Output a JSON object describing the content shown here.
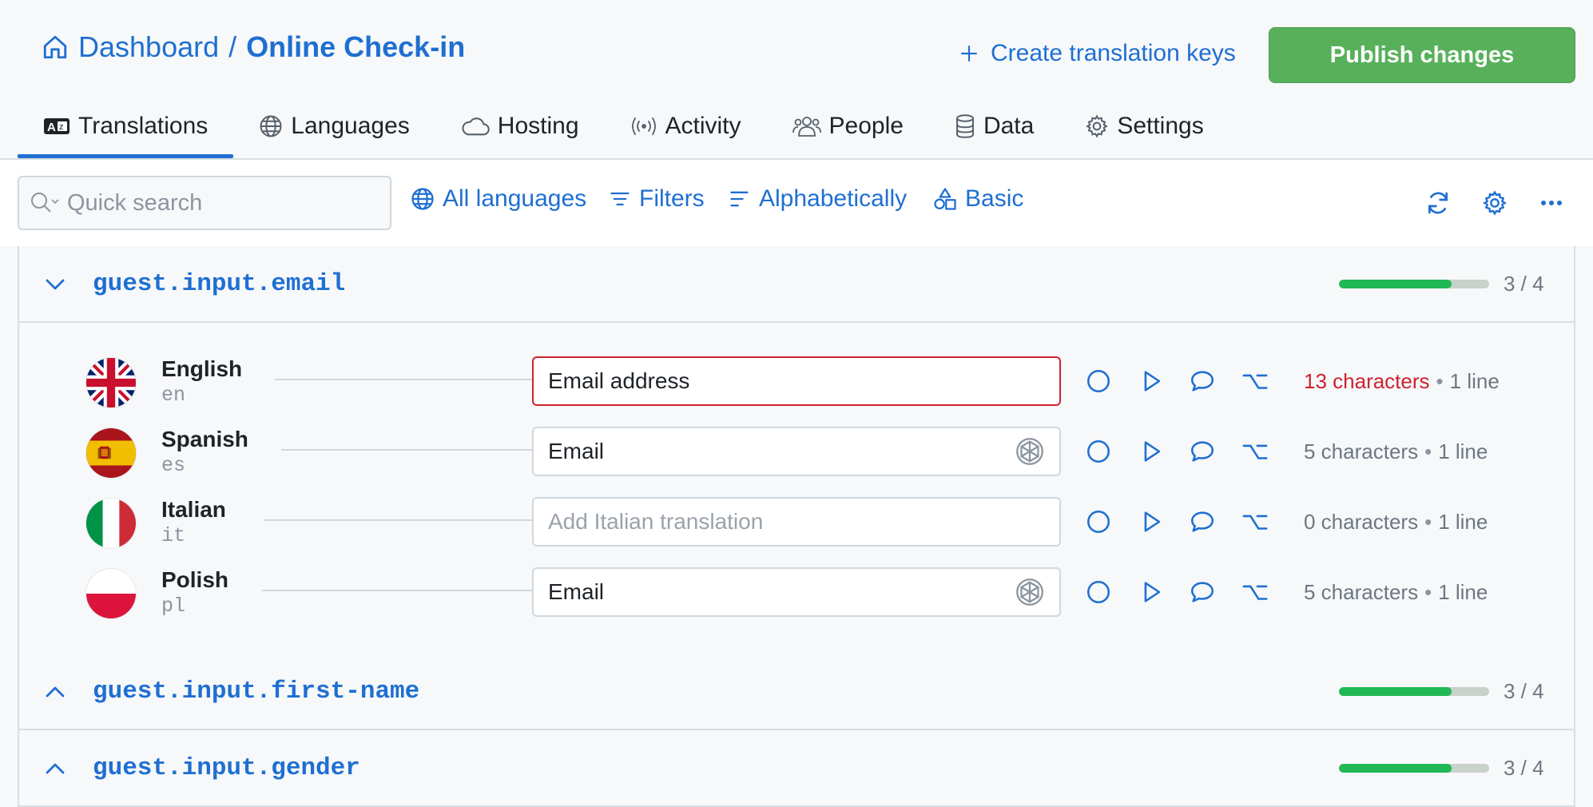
{
  "breadcrumb": {
    "root": "Dashboard",
    "separator": "/",
    "current": "Online Check-in"
  },
  "header": {
    "create_keys_label": "Create translation keys",
    "publish_label": "Publish changes"
  },
  "tabs": [
    {
      "label": "Translations",
      "icon": "translate-icon",
      "active": true
    },
    {
      "label": "Languages",
      "icon": "globe-icon"
    },
    {
      "label": "Hosting",
      "icon": "cloud-icon"
    },
    {
      "label": "Activity",
      "icon": "broadcast-icon"
    },
    {
      "label": "People",
      "icon": "people-icon"
    },
    {
      "label": "Data",
      "icon": "database-icon"
    },
    {
      "label": "Settings",
      "icon": "gear-icon"
    }
  ],
  "toolbar": {
    "search_placeholder": "Quick search",
    "languages_label": "All languages",
    "filters_label": "Filters",
    "sort_label": "Alphabetically",
    "view_label": "Basic"
  },
  "keys": [
    {
      "name": "guest.input.email",
      "expanded": true,
      "progress": 0.75,
      "progress_text": "3 / 4",
      "rows": [
        {
          "name": "English",
          "code": "en",
          "value": "Email address",
          "placeholder": "",
          "stats_chars": "13 characters",
          "stats_lines": "1 line",
          "error": true
        },
        {
          "name": "Spanish",
          "code": "es",
          "value": "Email",
          "placeholder": "",
          "stats_chars": "5 characters",
          "stats_lines": "1 line"
        },
        {
          "name": "Italian",
          "code": "it",
          "value": "",
          "placeholder": "Add Italian translation",
          "stats_chars": "0 characters",
          "stats_lines": "1 line"
        },
        {
          "name": "Polish",
          "code": "pl",
          "value": "Email",
          "placeholder": "",
          "stats_chars": "5 characters",
          "stats_lines": "1 line"
        }
      ]
    },
    {
      "name": "guest.input.first-name",
      "expanded": false,
      "progress": 0.75,
      "progress_text": "3 / 4"
    },
    {
      "name": "guest.input.gender",
      "expanded": false,
      "progress": 0.75,
      "progress_text": "3 / 4"
    }
  ],
  "colors": {
    "accent": "#1f6fd1",
    "publish": "#58b15a",
    "progress": "#1fb854",
    "error": "#cf222e"
  }
}
